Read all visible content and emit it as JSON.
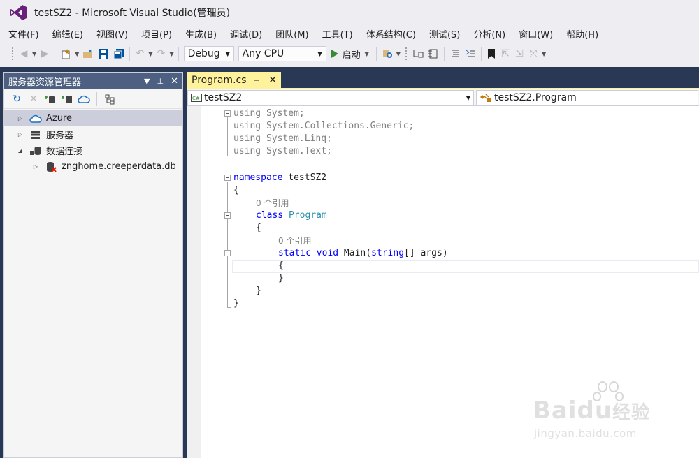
{
  "window": {
    "title": "testSZ2 - Microsoft Visual Studio(管理员)"
  },
  "menu": [
    "文件(F)",
    "编辑(E)",
    "视图(V)",
    "项目(P)",
    "生成(B)",
    "调试(D)",
    "团队(M)",
    "工具(T)",
    "体系结构(C)",
    "测试(S)",
    "分析(N)",
    "窗口(W)",
    "帮助(H)"
  ],
  "toolbar": {
    "configuration": "Debug",
    "platform": "Any CPU",
    "start_label": "启动"
  },
  "server_explorer": {
    "title": "服务器资源管理器",
    "tree": [
      {
        "label": "Azure",
        "expander": "▷",
        "icon": "cloud-icon",
        "level": 0,
        "selected": true
      },
      {
        "label": "服务器",
        "expander": "▷",
        "icon": "server-icon",
        "level": 0
      },
      {
        "label": "数据连接",
        "expander": "◢",
        "icon": "data-connection-icon",
        "level": 0
      },
      {
        "label": "znghome.creeperdata.db",
        "expander": "▷",
        "icon": "database-error-icon",
        "level": 1
      }
    ]
  },
  "editor": {
    "tab_label": "Program.cs",
    "nav_left": "testSZ2",
    "nav_right": "testSZ2.Program",
    "code": {
      "u1": "using",
      "u1b": " System;",
      "u2": "using",
      "u2b": " System.Collections.Generic;",
      "u3": "using",
      "u3b": " System.Linq;",
      "u4": "using",
      "u4b": " System.Text;",
      "ns": "namespace",
      "nsb": " testSZ2",
      "brace_open": "{",
      "ref1": "0 个引用",
      "cls": "class",
      "clsb": "Program",
      "ref2": "0 个引用",
      "st": "static",
      "vd": "void",
      "mn": " Main(",
      "strt": "string",
      "args": "[] args)",
      "brace_close": "}"
    }
  },
  "watermark": {
    "brand": "Baidu",
    "brand_cn": "经验",
    "url": "jingyan.baidu.com"
  }
}
